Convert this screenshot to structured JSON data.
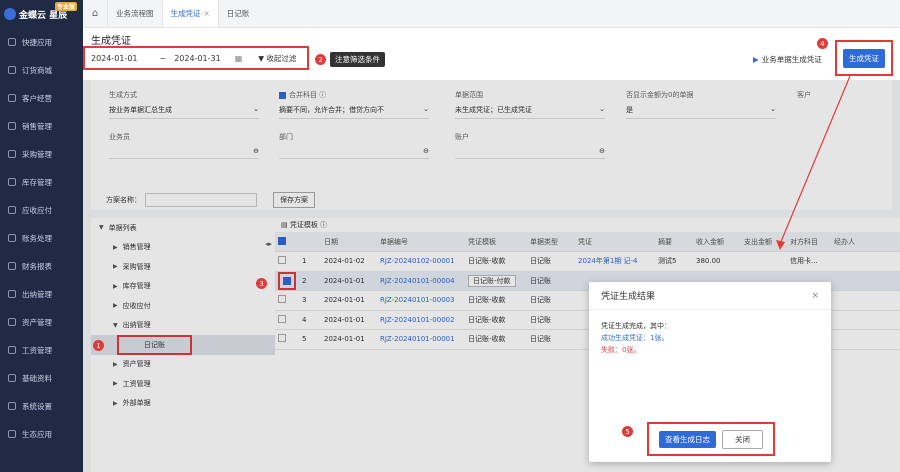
{
  "brand": {
    "name": "金蝶云 星辰",
    "tag": "专业版"
  },
  "sidebar": {
    "items": [
      {
        "label": "快捷应用"
      },
      {
        "label": "订货商城"
      },
      {
        "label": "客户经营"
      },
      {
        "label": "销售管理"
      },
      {
        "label": "采购管理"
      },
      {
        "label": "库存管理"
      },
      {
        "label": "应收应付"
      },
      {
        "label": "账务处理"
      },
      {
        "label": "财务报表"
      },
      {
        "label": "出纳管理"
      },
      {
        "label": "资产管理"
      },
      {
        "label": "工资管理"
      },
      {
        "label": "基础资料"
      },
      {
        "label": "系统设置"
      },
      {
        "label": "生态应用"
      }
    ]
  },
  "tabs": [
    {
      "label": "业务流程图"
    },
    {
      "label": "生成凭证",
      "close": "×"
    },
    {
      "label": "日记账"
    }
  ],
  "page": {
    "title": "生成凭证",
    "date_from": "2024-01-01",
    "date_sep": "~",
    "date_to": "2024-01-31",
    "collapse_filter": "收起过滤",
    "biz_voucher": "业务单据生成凭证",
    "generate": "生成凭证"
  },
  "annotations": {
    "tip": "注意筛选条件",
    "n1": "1",
    "n2": "2",
    "n3": "3",
    "n4": "4",
    "n5": "5"
  },
  "form": {
    "gen_method_label": "生成方式",
    "gen_method_value": "按业务单据汇总生成",
    "merge_label": "合并科目",
    "merge_value": "摘要不同，允许合并；借贷方向不",
    "scope_label": "单据范围",
    "scope_value": "未生成凭证；已生成凭证",
    "zero_label": "否显示金额为0的单据",
    "zero_value": "是",
    "customer_label": "客户",
    "salesman_label": "业务员",
    "dept_label": "部门",
    "account_label": "账户",
    "scheme_label": "方案名称：",
    "save_scheme": "保存方案"
  },
  "tree": {
    "root": "单据列表",
    "items": [
      {
        "label": "销售管理"
      },
      {
        "label": "采购管理"
      },
      {
        "label": "库存管理"
      },
      {
        "label": "应收应付"
      },
      {
        "label": "出纳管理"
      },
      {
        "label": "日记账"
      },
      {
        "label": "资产管理"
      },
      {
        "label": "工资管理"
      },
      {
        "label": "外部单据"
      }
    ]
  },
  "grid": {
    "template_label": "凭证模板",
    "columns": [
      "日期",
      "单据编号",
      "凭证模板",
      "单据类型",
      "凭证",
      "摘要",
      "收入金额",
      "支出金额",
      "对方科目",
      "经办人"
    ],
    "rows": [
      {
        "no": "1",
        "date": "2024-01-02",
        "code": "RJZ-20240102-00001",
        "tpl": "日记账-收款",
        "type": "日记账",
        "voucher": "2024年第1期 记-4",
        "memo": "测试5",
        "income": "380.00",
        "expense": "",
        "account": "信用卡...",
        "handler": ""
      },
      {
        "no": "2",
        "date": "2024-01-01",
        "code": "RJZ-20240101-00004",
        "tpl": "日记账-付款",
        "type": "日记账",
        "voucher": "",
        "memo": "",
        "income": "",
        "expense": "",
        "account": "",
        "handler": ""
      },
      {
        "no": "3",
        "date": "2024-01-01",
        "code": "RJZ-20240101-00003",
        "tpl": "日记账-收款",
        "type": "日记账",
        "voucher": "",
        "memo": "",
        "income": "",
        "expense": "",
        "account": "",
        "handler": ""
      },
      {
        "no": "4",
        "date": "2024-01-01",
        "code": "RJZ-20240101-00002",
        "tpl": "日记账-收款",
        "type": "日记账",
        "voucher": "",
        "memo": "",
        "income": "",
        "expense": "",
        "account": "",
        "handler": ""
      },
      {
        "no": "5",
        "date": "2024-01-01",
        "code": "RJZ-20240101-00001",
        "tpl": "日记账-收款",
        "type": "日记账",
        "voucher": "",
        "memo": "",
        "income": "",
        "expense": "",
        "account": "",
        "handler": ""
      }
    ]
  },
  "modal": {
    "title": "凭证生成结果",
    "close": "×",
    "summary": "凭证生成完成，其中：",
    "success": "成功生成凭证：1张。",
    "fail": "失败：0张。",
    "view_log": "查看生成日志",
    "close_btn": "关闭"
  },
  "colors": {
    "primary": "#2f6ad9",
    "annotation": "#e03b3b",
    "sidebar": "#1f2a44"
  }
}
